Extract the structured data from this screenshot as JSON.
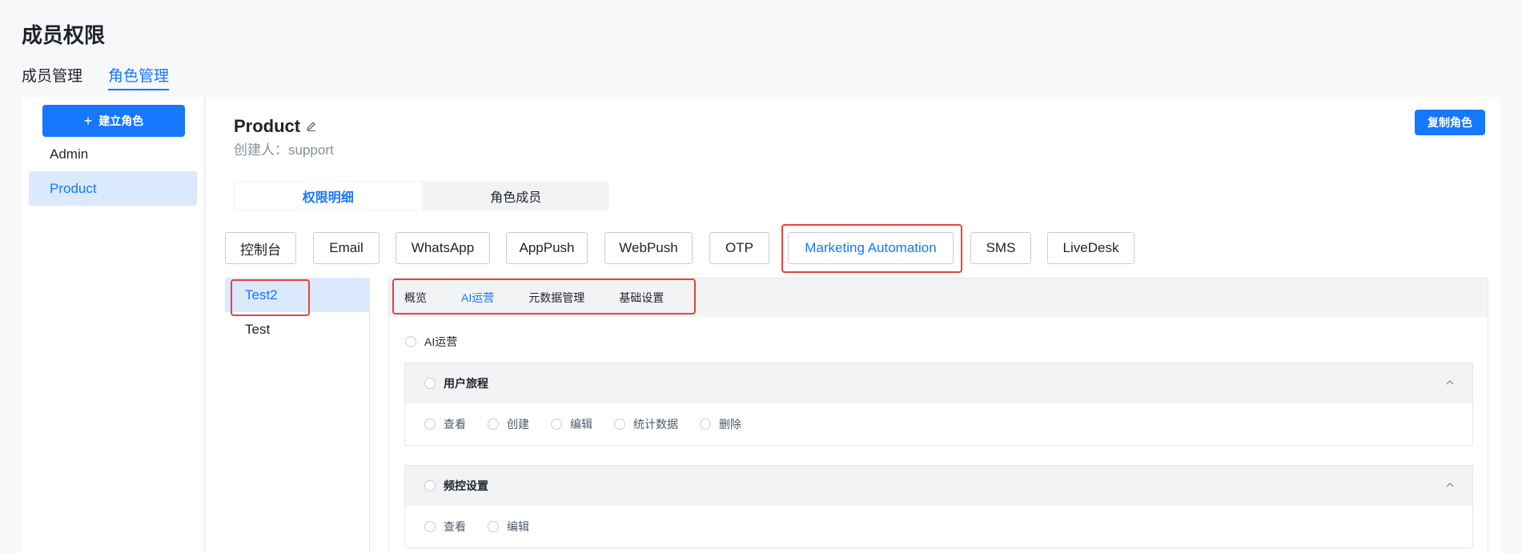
{
  "page": {
    "title": "成员权限"
  },
  "top_tabs": [
    {
      "label": "成员管理",
      "active": false
    },
    {
      "label": "角色管理",
      "active": true
    }
  ],
  "sidebar": {
    "add_role_label": "建立角色",
    "roles": [
      {
        "label": "Admin",
        "active": false
      },
      {
        "label": "Product",
        "active": true
      }
    ]
  },
  "role": {
    "name": "Product",
    "creator": "创建人：support",
    "copy_label": "复制角色"
  },
  "segment": [
    {
      "label": "权限明细",
      "active": true
    },
    {
      "label": "角色成员",
      "active": false
    }
  ],
  "channels": [
    {
      "label": "控制台"
    },
    {
      "label": "Email"
    },
    {
      "label": "WhatsApp"
    },
    {
      "label": "AppPush"
    },
    {
      "label": "WebPush"
    },
    {
      "label": "OTP"
    },
    {
      "label": "Marketing Automation",
      "active": true
    },
    {
      "label": "SMS"
    },
    {
      "label": "LiveDesk"
    }
  ],
  "sub_items": [
    {
      "label": "Test2",
      "active": true
    },
    {
      "label": "Test",
      "active": false
    }
  ],
  "perm_tabs": [
    {
      "label": "概览",
      "active": false
    },
    {
      "label": "AI运营",
      "active": true
    },
    {
      "label": "元数据管理",
      "active": false
    },
    {
      "label": "基础设置",
      "active": false
    }
  ],
  "section": {
    "label": "AI运营"
  },
  "groups": [
    {
      "title": "用户旅程",
      "options": [
        "查看",
        "创建",
        "编辑",
        "统计数据",
        "删除"
      ]
    },
    {
      "title": "频控设置",
      "options": [
        "查看",
        "编辑"
      ]
    }
  ],
  "colors": {
    "accent": "#1677ff",
    "highlight": "#e8443a",
    "active_bg": "#dbe9fc"
  }
}
